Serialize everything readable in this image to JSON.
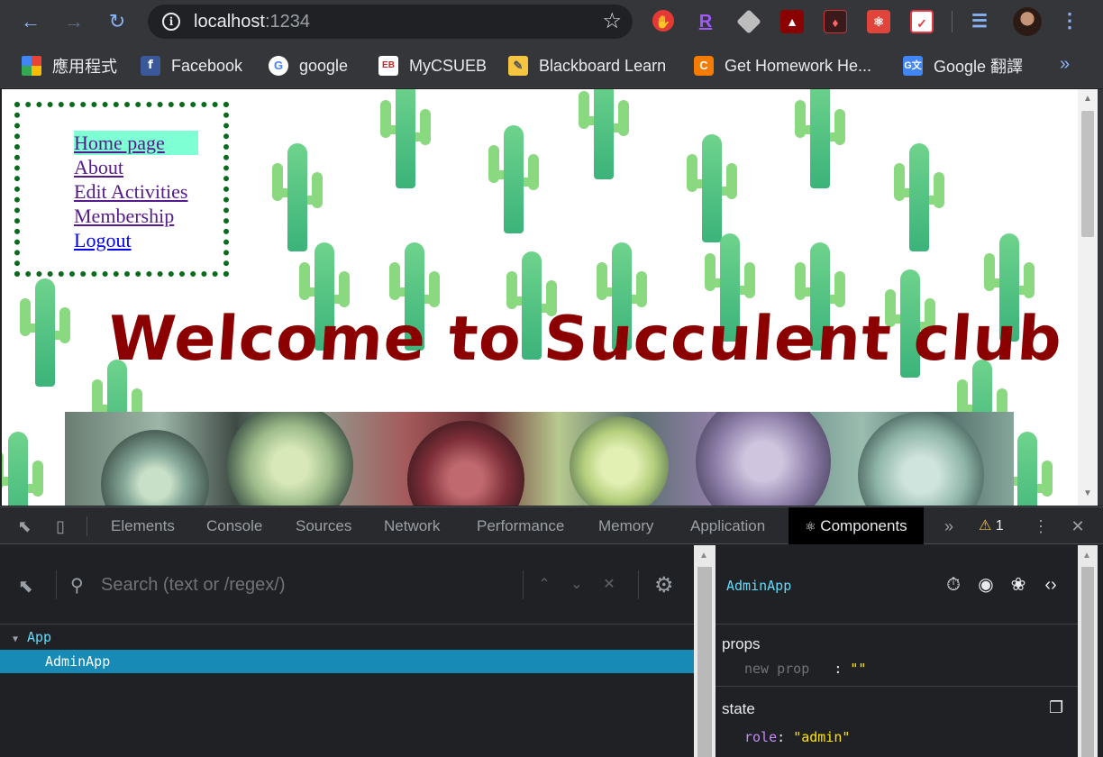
{
  "browser": {
    "url_host": "localhost",
    "url_port": ":1234",
    "bookmarks": [
      {
        "label": "應用程式",
        "icon": "apps-grid-icon"
      },
      {
        "label": "Facebook",
        "icon": "facebook-icon"
      },
      {
        "label": "google",
        "icon": "google-icon"
      },
      {
        "label": "MyCSUEB",
        "icon": "eb-icon"
      },
      {
        "label": "Blackboard Learn",
        "icon": "blackboard-icon"
      },
      {
        "label": "Get Homework He...",
        "icon": "chegg-icon"
      },
      {
        "label": "Google 翻譯",
        "icon": "google-translate-icon"
      }
    ]
  },
  "page": {
    "nav": [
      {
        "label": "Home page"
      },
      {
        "label": "About"
      },
      {
        "label": "Edit Activities"
      },
      {
        "label": "Membership"
      },
      {
        "label": "Logout"
      }
    ],
    "heading": "Welcome to Succulent club",
    "colors": {
      "heading": "#8b0000",
      "nav_border": "#0a6b1d",
      "nav_highlight": "#7fffd4"
    }
  },
  "devtools": {
    "tabs": [
      "Elements",
      "Console",
      "Sources",
      "Network",
      "Performance",
      "Memory",
      "Application",
      "Components"
    ],
    "active_tab": "Components",
    "warning_count": "1",
    "search_placeholder": "Search (text or /regex/)",
    "tree": {
      "root": "App",
      "child": "AdminApp"
    },
    "selected_component": "AdminApp",
    "props_title": "props",
    "props": [
      {
        "key": "new prop",
        "colon": ":",
        "value": "\"\""
      }
    ],
    "state_title": "state",
    "state": [
      {
        "key": "role",
        "colon": ":",
        "value": "\"admin\""
      }
    ]
  }
}
